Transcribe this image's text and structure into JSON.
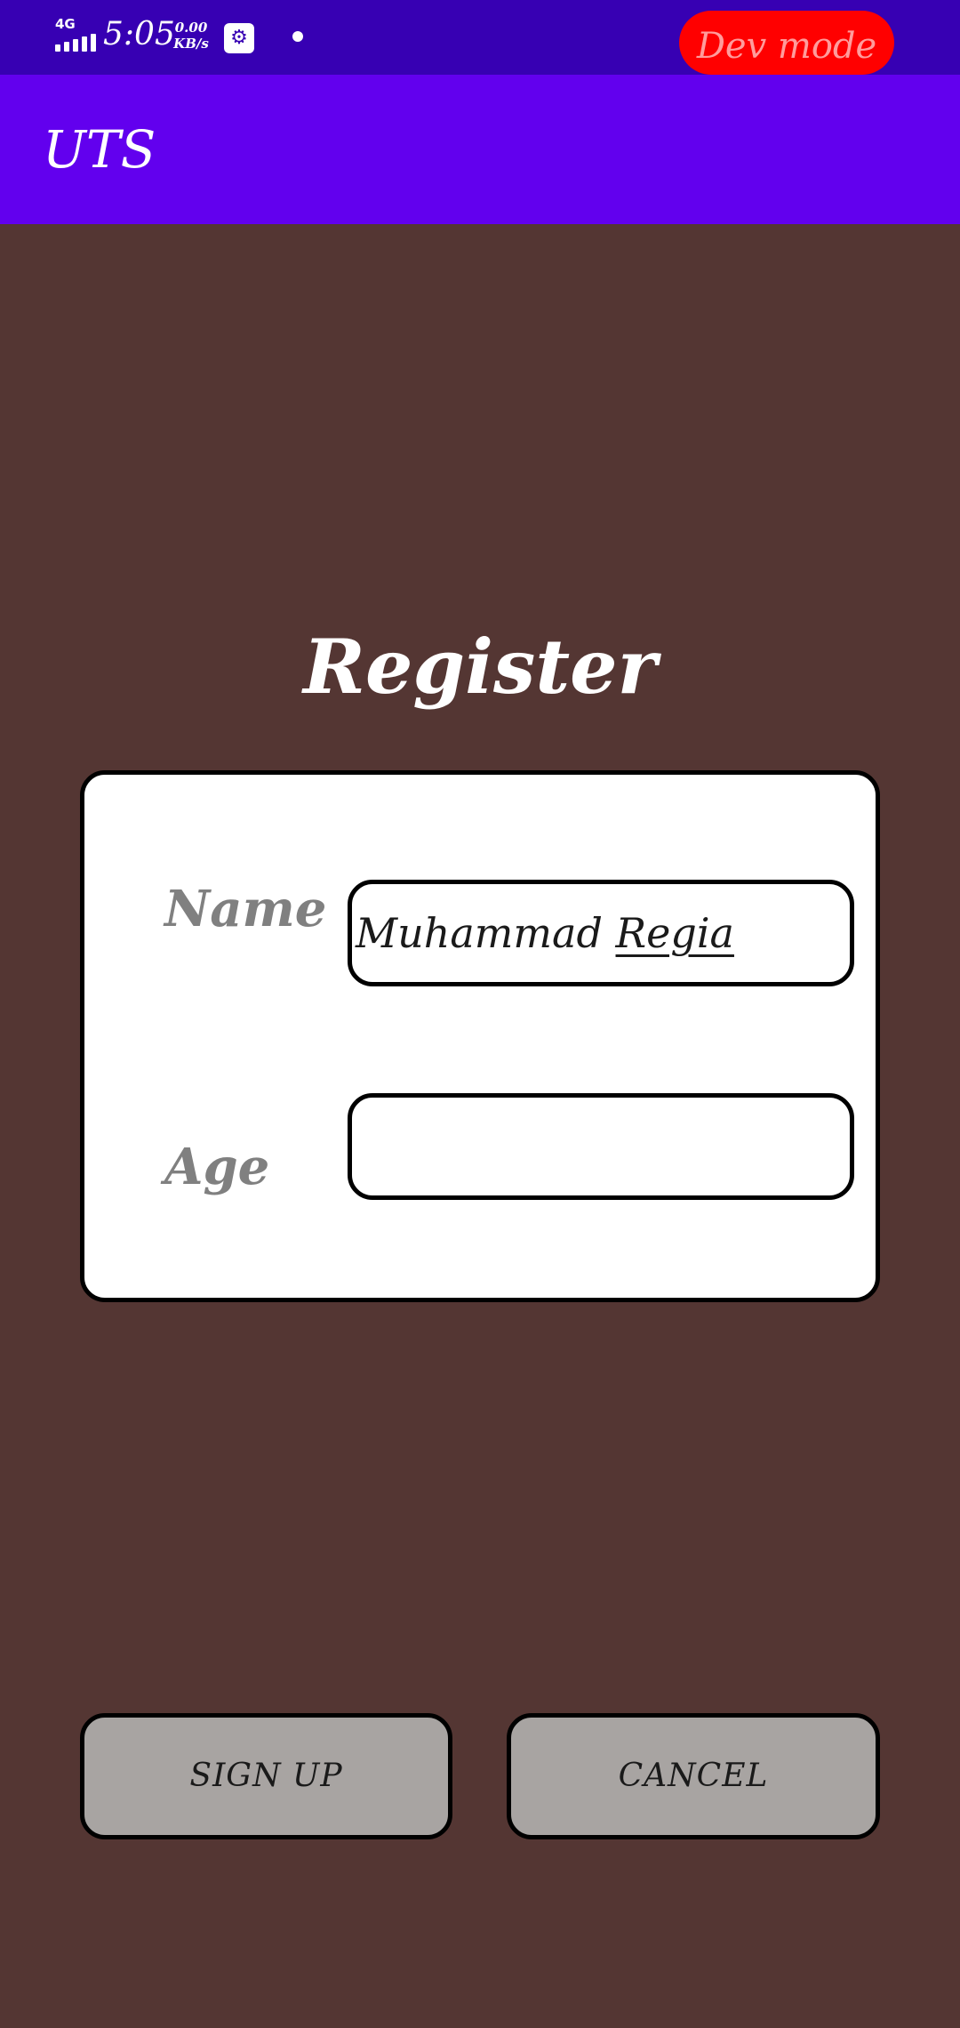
{
  "status_bar": {
    "network": "4G",
    "time": "5:05",
    "speed_value": "0.00",
    "speed_unit": "KB/s",
    "usb_icon": "usb-debug-icon",
    "dev_mode": "Dev mode"
  },
  "app_bar": {
    "title": "UTS"
  },
  "form": {
    "title": "Register",
    "name_label": "Name",
    "name_value_first": "Muhammad",
    "name_value_second": "Regia",
    "age_label": "Age",
    "age_value": ""
  },
  "actions": {
    "signup_label": "SIGN UP",
    "cancel_label": "CANCEL"
  },
  "colors": {
    "status_bar": "#3700b3",
    "app_bar": "#6200ee",
    "background": "#543633",
    "button": "#a8a4a2",
    "dev_mode_badge": "#ff0000"
  }
}
